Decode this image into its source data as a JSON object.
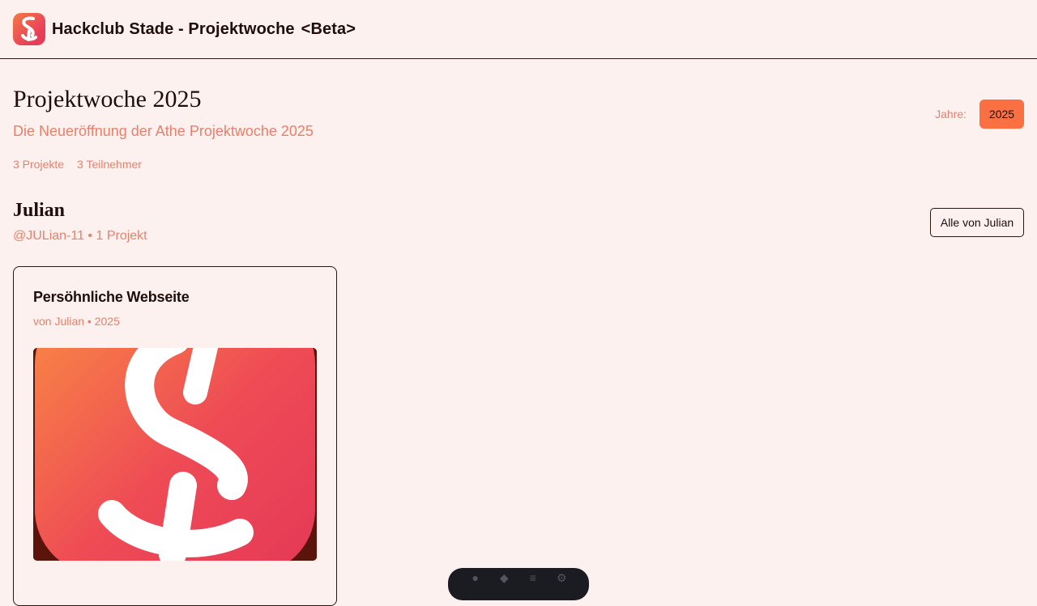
{
  "header": {
    "title": "Hackclub Stade - Projektwoche",
    "badge": "<Beta>",
    "logo_icon": "hackclub-stade-logo-icon"
  },
  "hero": {
    "title": "Projektwoche 2025",
    "subtitle": "Die Neueröffnung der Athe Projektwoche 2025",
    "stats": [
      "3 Projekte",
      "3 Teilnehmer"
    ]
  },
  "years": {
    "label": "Jahre:",
    "options": [
      "2025"
    ],
    "selected": "2025"
  },
  "person": {
    "name": "Julian",
    "meta": "@JULian-11 • 1 Projekt",
    "all_button": "Alle von Julian"
  },
  "projects": [
    {
      "title": "Persöhnliche Webseite",
      "meta": "von Julian • 2025",
      "image_icon": "hackclub-stade-logo-icon"
    }
  ],
  "toolbar": {
    "icons": [
      "microphone-icon",
      "paint-icon",
      "menu-icon",
      "settings-icon"
    ]
  },
  "colors": {
    "background": "#fdf1ef",
    "accent": "#fb7043",
    "muted_text": "#e8806b",
    "text": "#1e0d08"
  }
}
